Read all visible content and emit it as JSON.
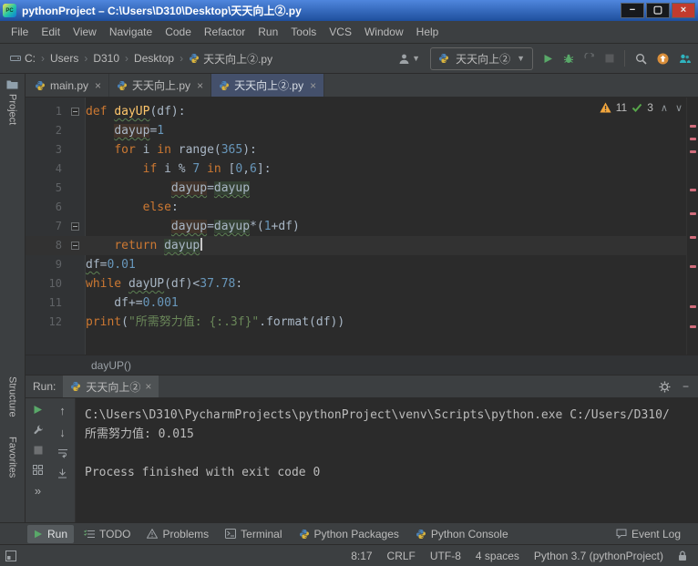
{
  "window": {
    "title": "pythonProject – C:\\Users\\D310\\Desktop\\天天向上②.py",
    "buttons": {
      "minimize": "−",
      "maximize": "▢",
      "close": "×"
    }
  },
  "menu": {
    "items": [
      "File",
      "Edit",
      "View",
      "Navigate",
      "Code",
      "Refactor",
      "Run",
      "Tools",
      "VCS",
      "Window",
      "Help"
    ]
  },
  "navbar": {
    "breadcrumbs": [
      {
        "label": "C:",
        "icon": "drive"
      },
      {
        "label": "Users"
      },
      {
        "label": "D310"
      },
      {
        "label": "Desktop"
      },
      {
        "label": "天天向上②.py",
        "icon": "python"
      }
    ],
    "run_config": {
      "label": "天天向上②",
      "icon": "python"
    },
    "actions": [
      {
        "name": "run",
        "icon": "play"
      },
      {
        "name": "debug",
        "icon": "bug"
      },
      {
        "name": "run-with-coverage",
        "icon": "coverage",
        "disabled": true
      },
      {
        "name": "stop",
        "icon": "stop",
        "disabled": true
      },
      {
        "name": "separator"
      },
      {
        "name": "search-everywhere",
        "icon": "search"
      },
      {
        "name": "update-notification",
        "icon": "update"
      },
      {
        "name": "code-with-me",
        "icon": "codewithme"
      }
    ]
  },
  "editor_tabs": [
    {
      "label": "main.py",
      "active": false
    },
    {
      "label": "天天向上.py",
      "active": false
    },
    {
      "label": "天天向上②.py",
      "active": true
    }
  ],
  "left_stripe": {
    "project": "Project",
    "structure": "Structure",
    "favorites": "Favorites"
  },
  "editor": {
    "inspections": {
      "warning_count": "11",
      "ok_count": "3"
    },
    "breadcrumb": "dayUP()",
    "lines": [
      {
        "n": "1",
        "mark": true,
        "tokens": [
          [
            "kw",
            "def"
          ],
          [
            "pl",
            " "
          ],
          [
            "fnu",
            "dayUP"
          ],
          [
            "pl",
            "(df):"
          ]
        ]
      },
      {
        "n": "2",
        "tokens": [
          [
            "pl",
            "    "
          ],
          [
            "idw",
            "dayup"
          ],
          [
            "pl",
            "="
          ],
          [
            "num",
            "1"
          ]
        ]
      },
      {
        "n": "3",
        "tokens": [
          [
            "pl",
            "    "
          ],
          [
            "kw",
            "for"
          ],
          [
            "pl",
            " i "
          ],
          [
            "kw",
            "in"
          ],
          [
            "pl",
            " range("
          ],
          [
            "num",
            "365"
          ],
          [
            "pl",
            "):"
          ]
        ]
      },
      {
        "n": "4",
        "tokens": [
          [
            "pl",
            "        "
          ],
          [
            "kw",
            "if"
          ],
          [
            "pl",
            " i % "
          ],
          [
            "num",
            "7"
          ],
          [
            "pl",
            " "
          ],
          [
            "kw",
            "in"
          ],
          [
            "pl",
            " ["
          ],
          [
            "num",
            "0"
          ],
          [
            "pl",
            ","
          ],
          [
            "num",
            "6"
          ],
          [
            "pl",
            "]:"
          ]
        ]
      },
      {
        "n": "5",
        "tokens": [
          [
            "pl",
            "            "
          ],
          [
            "idw",
            "dayup"
          ],
          [
            "pl",
            "="
          ],
          [
            "idr",
            "dayup"
          ]
        ]
      },
      {
        "n": "6",
        "tokens": [
          [
            "pl",
            "        "
          ],
          [
            "kw",
            "else"
          ],
          [
            "pl",
            ":"
          ]
        ]
      },
      {
        "n": "7",
        "mark": true,
        "tokens": [
          [
            "pl",
            "            "
          ],
          [
            "idw",
            "dayup"
          ],
          [
            "pl",
            "="
          ],
          [
            "idr",
            "dayup"
          ],
          [
            "pl",
            "*("
          ],
          [
            "num",
            "1"
          ],
          [
            "pl",
            "+df)"
          ]
        ]
      },
      {
        "n": "8",
        "mark": true,
        "caret": true,
        "tokens": [
          [
            "pl",
            "    "
          ],
          [
            "kw",
            "return"
          ],
          [
            "pl",
            " "
          ],
          [
            "idr",
            "dayup"
          ]
        ]
      },
      {
        "n": "9",
        "tokens": [
          [
            "plu",
            "df"
          ],
          [
            "pl",
            "="
          ],
          [
            "num",
            "0.01"
          ]
        ]
      },
      {
        "n": "10",
        "tokens": [
          [
            "kw",
            "while"
          ],
          [
            "pl",
            " "
          ],
          [
            "plu",
            "dayUP"
          ],
          [
            "pl",
            "(df)<"
          ],
          [
            "num",
            "37.78"
          ],
          [
            "pl",
            ":"
          ]
        ]
      },
      {
        "n": "11",
        "tokens": [
          [
            "pl",
            "    df+="
          ],
          [
            "num",
            "0.001"
          ]
        ]
      },
      {
        "n": "12",
        "tokens": [
          [
            "kw",
            "print"
          ],
          [
            "pl",
            "("
          ],
          [
            "str",
            "\"所需努力值: {:.3f}\""
          ],
          [
            "pl",
            ".format(df))"
          ]
        ]
      }
    ],
    "stripe_marks": [
      30,
      44,
      58,
      100,
      126,
      152,
      184,
      228,
      250
    ]
  },
  "run_panel": {
    "title": "Run:",
    "tab": {
      "label": "天天向上②",
      "icon": "python"
    },
    "toolbar_left": [
      "play",
      "wrench",
      "stop",
      "grid",
      "more"
    ],
    "toolbar_right": [
      "up",
      "down",
      "softwrap",
      "scrollend"
    ],
    "console": [
      {
        "text": "C:\\Users\\D310\\PycharmProjects\\pythonProject\\venv\\Scripts\\python.exe C:/Users/D310/"
      },
      {
        "text": "所需努力值: 0.015"
      },
      {
        "text": ""
      },
      {
        "text": "Process finished with exit code 0"
      }
    ]
  },
  "bottom_bar": {
    "left": [
      {
        "label": "Run",
        "icon": "run",
        "active": true
      },
      {
        "label": "TODO",
        "icon": "todo"
      },
      {
        "label": "Problems",
        "icon": "problems"
      },
      {
        "label": "Terminal",
        "icon": "terminal"
      },
      {
        "label": "Python Packages",
        "icon": "python"
      },
      {
        "label": "Python Console",
        "icon": "python"
      }
    ],
    "right": [
      {
        "label": "Event Log",
        "icon": "event"
      }
    ]
  },
  "status_bar": {
    "items": [
      "8:17",
      "CRLF",
      "UTF-8",
      "4 spaces",
      "Python 3.7 (pythonProject)"
    ]
  },
  "colors": {
    "titlebar_blue": "#2f6bd0",
    "panel_gray": "#3c3f41",
    "editor_bg": "#2b2b2b",
    "run_green": "#59a869",
    "warning_yellow": "#f2a63c",
    "ok_green": "#57a64a",
    "error_stripe_pink": "#d16d7c",
    "keyword_orange": "#cc7832",
    "number_blue": "#6897bb",
    "string_green": "#6a8759",
    "active_tab_blue": "#44506b"
  }
}
